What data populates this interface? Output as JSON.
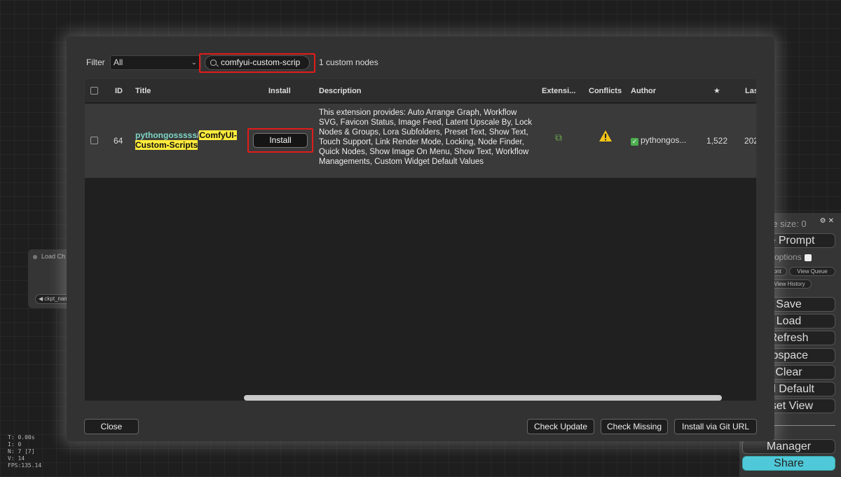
{
  "background": {
    "node": {
      "title": "Load Ch",
      "widget": "ckpt_nam"
    },
    "stats": [
      "T: 0.00s",
      "I: 0",
      "N: 7 [7]",
      "V: 14",
      "FPS:135.14"
    ],
    "panel": {
      "queue_size": "ue size: 0",
      "queue_prompt": "ue Prompt",
      "extra_options": "a options",
      "small_buttons": [
        "ont",
        "View Queue",
        "View History"
      ],
      "buttons": [
        "Save",
        "Load",
        "Refresh",
        "ipspace",
        "Clear",
        "ad Default",
        "eset View"
      ],
      "manager": "Manager",
      "share": "Share",
      "share_color": "#4fc9d9"
    }
  },
  "modal": {
    "filter_label": "Filter",
    "filter_value": "All",
    "search": {
      "value": "comfyui-custom-scrip",
      "placeholder": "Search"
    },
    "count_text": "1 custom nodes",
    "highlight_color": "#e31b1b",
    "columns": {
      "id": "ID",
      "title": "Title",
      "install": "Install",
      "description": "Description",
      "extensions": "Extensi...",
      "conflicts": "Conflicts",
      "author": "Author",
      "stars": "★",
      "last": "Las"
    },
    "rows": [
      {
        "id": "64",
        "author_part": "pythongosssss",
        "slash": "/",
        "name_part": "ComfyUI-Custom-Scripts",
        "install_label": "Install",
        "description": "This extension provides: Auto Arrange Graph, Workflow SVG, Favicon Status, Image Feed, Latent Upscale By, Lock Nodes & Groups, Lora Subfolders, Preset Text, Show Text, Touch Support, Link Render Mode, Locking, Node Finder, Quick Nodes, Show Image On Menu, Show Text, Workflow Managements, Custom Widget Default Values",
        "extension_icon": "puzzle-icon",
        "conflict_icon": "warning-icon",
        "author": "pythongos...",
        "stars": "1,522",
        "last_update": "202"
      }
    ],
    "buttons": {
      "close": "Close",
      "check_update": "Check Update",
      "check_missing": "Check Missing",
      "install_git": "Install via Git URL"
    }
  }
}
